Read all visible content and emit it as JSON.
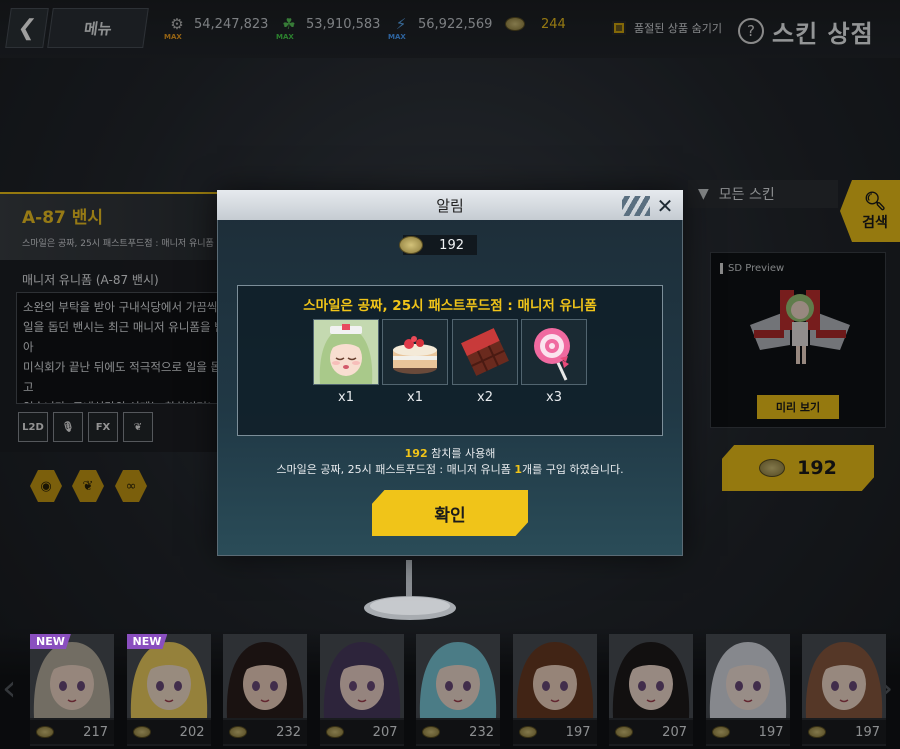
{
  "topbar": {
    "menu_label": "메뉴",
    "resources": [
      {
        "icon": "gear-icon",
        "value": "54,247,823",
        "badge": "MAX"
      },
      {
        "icon": "leaf-icon",
        "value": "53,910,583",
        "badge": "MAX"
      },
      {
        "icon": "lightning-icon",
        "value": "56,922,569",
        "badge": "MAX"
      },
      {
        "icon": "coin-icon",
        "value": "244"
      }
    ],
    "hide_soldout_label": "품절된 상품 숨기기",
    "page_title": "스킨 상점"
  },
  "skin_panel": {
    "name": "A-87 밴시",
    "subtitle": "스마일은 공짜, 25시 패스트푸드점 : 매니저 유니폼",
    "costume": "매니저 유니폼 (A-87 밴시)",
    "description": "소완의 부탁을 받아 구내식당에서 가끔씩\n일을 돕던 밴시는 최근 매니저 유니폼을 받아\n미식회가 끝난 뒤에도 적극적으로 일을 돕고\n있습니다. 구내식당의 신메뉴 참치버거!\n맛보지 않을 수 없겠죠? 영양 만점 최고의",
    "features": [
      "L2D",
      "FX"
    ]
  },
  "right_panel": {
    "filter_label": "모든 스킨",
    "search_label": "검색",
    "sd_label": "SD Preview",
    "preview_label": "미리 보기",
    "price": "192"
  },
  "modal": {
    "title": "알림",
    "cost": "192",
    "item_title": "스마일은 공짜, 25시 패스트푸드점 : 매니저 유니폼",
    "items": [
      {
        "icon": "portrait-icon",
        "qty": "x1"
      },
      {
        "icon": "cake-icon",
        "qty": "x1"
      },
      {
        "icon": "chocolate-icon",
        "qty": "x2"
      },
      {
        "icon": "lollipop-icon",
        "qty": "x3"
      }
    ],
    "used_amount": "192",
    "used_suffix": " 참치를 사용해",
    "bought_prefix": "스마일은 공짜, 25시 패스트푸드점 : 매니저 유니폼 ",
    "bought_count": "1",
    "bought_suffix": "개를 구입 하였습니다.",
    "confirm_label": "확인"
  },
  "carousel": {
    "new_label": "NEW",
    "cards": [
      {
        "price": "217",
        "new": true,
        "hair": "#b8b0a0",
        "skin": "#f2d9c8"
      },
      {
        "price": "202",
        "new": true,
        "hair": "#f0d060",
        "skin": "#f6e0cc"
      },
      {
        "price": "232",
        "new": false,
        "hair": "#2a1e1c",
        "skin": "#f1d2c0"
      },
      {
        "price": "207",
        "new": false,
        "hair": "#4a3a60",
        "skin": "#f0d6cc"
      },
      {
        "price": "232",
        "new": false,
        "hair": "#7ac8d8",
        "skin": "#f3ddd0"
      },
      {
        "price": "197",
        "new": false,
        "hair": "#6a3a22",
        "skin": "#f2d6c2"
      },
      {
        "price": "207",
        "new": false,
        "hair": "#1e1a1a",
        "skin": "#f4ddd0"
      },
      {
        "price": "197",
        "new": false,
        "hair": "#d8dce4",
        "skin": "#f6e4da"
      },
      {
        "price": "197",
        "new": false,
        "hair": "#8a5a40",
        "skin": "#f4dccb"
      }
    ]
  },
  "colors": {
    "accent": "#f0c419",
    "new_badge": "#8a4fbf",
    "modal_bg": "#203845"
  }
}
